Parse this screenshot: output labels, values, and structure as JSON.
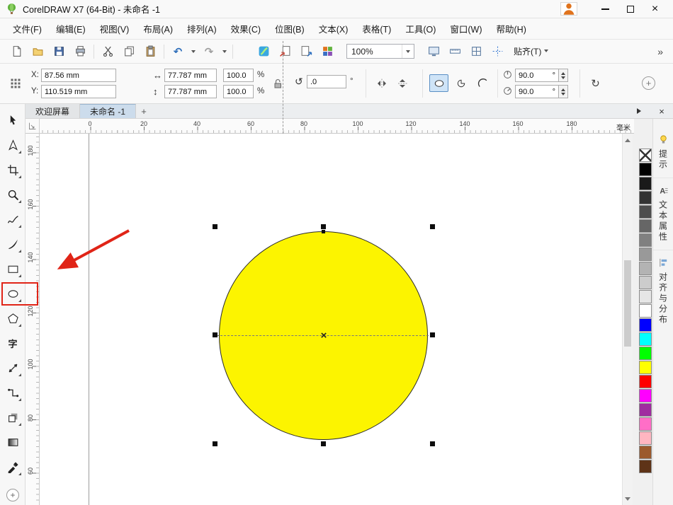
{
  "window": {
    "title": "CorelDRAW X7 (64-Bit) - 未命名 -1"
  },
  "menus": [
    "文件(F)",
    "编辑(E)",
    "视图(V)",
    "布局(A)",
    "排列(A)",
    "效果(C)",
    "位图(B)",
    "文本(X)",
    "表格(T)",
    "工具(O)",
    "窗口(W)",
    "帮助(H)"
  ],
  "toolbar": {
    "zoom_value": "100%",
    "snap_label": "贴齐(T)",
    "overflow": "»"
  },
  "property_bar": {
    "x_label": "X:",
    "x_value": "87.56 mm",
    "y_label": "Y:",
    "y_value": "110.519 mm",
    "width_value": "77.787 mm",
    "height_value": "77.787 mm",
    "scale_x": "100.0",
    "scale_y": "100.0",
    "percent": "%",
    "rotation_value": ".0",
    "degree": "°",
    "start_angle": "90.0",
    "end_angle": "90.0"
  },
  "document_tabs": {
    "welcome": "欢迎屏幕",
    "current": "未命名 -1",
    "add_label": "+"
  },
  "rulers": {
    "unit": "毫米",
    "h": [
      "0",
      "20",
      "40",
      "60",
      "80",
      "100",
      "120",
      "140",
      "160",
      "180"
    ],
    "v": [
      "180",
      "160",
      "140",
      "120",
      "100",
      "80",
      "60"
    ]
  },
  "toolbox": {
    "text_tool_glyph": "字",
    "tools": [
      "pick",
      "shape",
      "crop",
      "zoom",
      "freehand",
      "artistic-media",
      "rectangle",
      "ellipse",
      "polygon",
      "text",
      "parallel-dimension",
      "connector",
      "drop-shadow",
      "transparency",
      "color-eyedropper"
    ]
  },
  "canvas": {
    "shape": {
      "type": "ellipse",
      "fill": "#FCF400",
      "stroke": "#2b2b2b"
    }
  },
  "palette": {
    "swatches": [
      {
        "name": "no-color",
        "hex": null
      },
      {
        "name": "black",
        "hex": "#000000"
      },
      {
        "name": "90-black",
        "hex": "#1a1a1a"
      },
      {
        "name": "80-black",
        "hex": "#333333"
      },
      {
        "name": "70-black",
        "hex": "#4d4d4d"
      },
      {
        "name": "60-black",
        "hex": "#666666"
      },
      {
        "name": "50-black",
        "hex": "#808080"
      },
      {
        "name": "40-black",
        "hex": "#999999"
      },
      {
        "name": "30-black",
        "hex": "#b3b3b3"
      },
      {
        "name": "20-black",
        "hex": "#cccccc"
      },
      {
        "name": "10-black",
        "hex": "#e6e6e6"
      },
      {
        "name": "white",
        "hex": "#ffffff"
      },
      {
        "name": "blue",
        "hex": "#0000ff"
      },
      {
        "name": "cyan",
        "hex": "#00ffff"
      },
      {
        "name": "green",
        "hex": "#00ff00"
      },
      {
        "name": "yellow",
        "hex": "#ffff00"
      },
      {
        "name": "red",
        "hex": "#ff0000"
      },
      {
        "name": "magenta",
        "hex": "#ff00ff"
      },
      {
        "name": "purple",
        "hex": "#a02ca0"
      },
      {
        "name": "pink",
        "hex": "#ff6ec7"
      },
      {
        "name": "light-pink",
        "hex": "#ffb6c1"
      },
      {
        "name": "brown",
        "hex": "#9c5a2d"
      },
      {
        "name": "dark-brown",
        "hex": "#5e3317"
      }
    ]
  },
  "dockers": {
    "tabs": [
      "提示",
      "文本属性",
      "对齐与分布"
    ]
  }
}
